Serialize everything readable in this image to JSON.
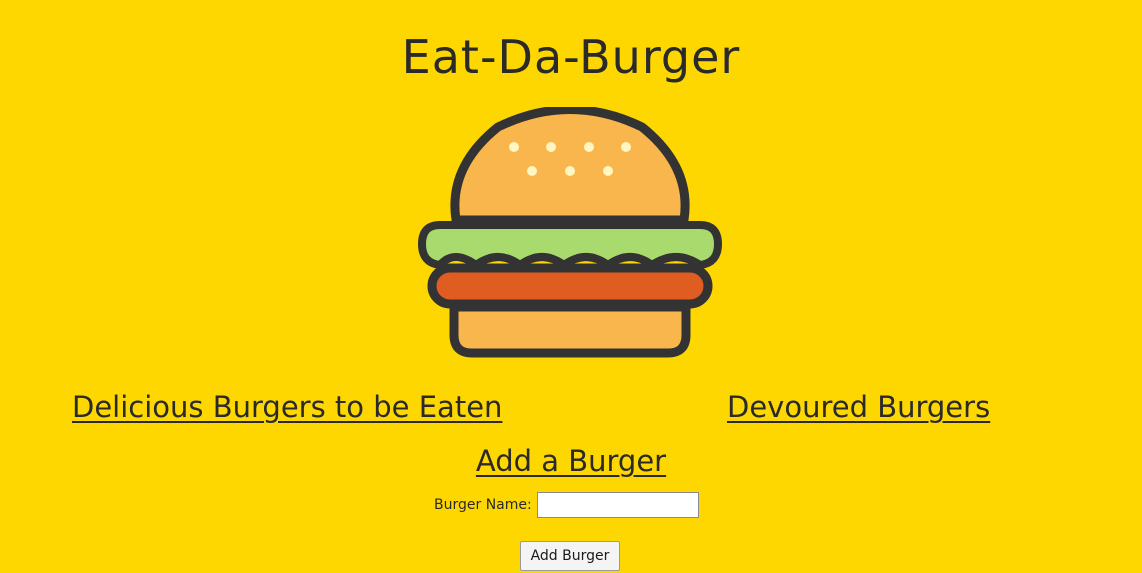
{
  "header": {
    "title": "Eat-Da-Burger",
    "logo_icon": "burger-icon"
  },
  "columns": {
    "uneaten_heading": "Delicious Burgers to be Eaten",
    "devoured_heading": "Devoured Burgers"
  },
  "add_form": {
    "heading": "Add a Burger",
    "name_label": "Burger Name:",
    "name_value": "",
    "submit_label": "Add Burger"
  },
  "colors": {
    "background": "#FFD700",
    "text": "#2a2a2a",
    "bun": "#F8B64C",
    "lettuce": "#A8DA6E",
    "patty": "#E05D22",
    "outline": "#333333",
    "sesame": "#FFF6C2"
  }
}
